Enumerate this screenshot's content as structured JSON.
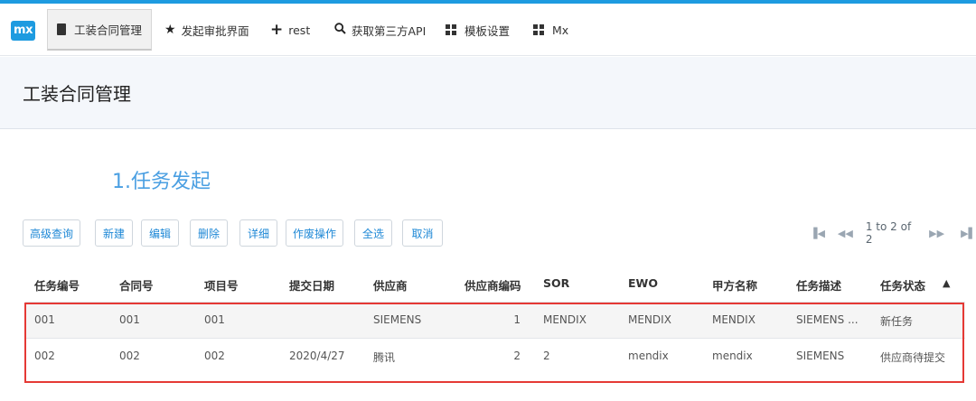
{
  "brand": {
    "logo_text": "mx"
  },
  "nav": [
    {
      "label": "工装合同管理",
      "icon": "book-icon",
      "active": true
    },
    {
      "label": "发起审批界面",
      "icon": "star-icon"
    },
    {
      "label": "rest",
      "icon": "plus-icon"
    },
    {
      "label": "获取第三方API",
      "icon": "search-icon"
    },
    {
      "label": "模板设置",
      "icon": "grid-icon"
    },
    {
      "label": "Mx",
      "icon": "grid-icon"
    }
  ],
  "page": {
    "title": "工装合同管理",
    "section_title": "1.任务发起"
  },
  "toolbar": [
    {
      "label": "高级查询"
    },
    {
      "label": "新建"
    },
    {
      "label": "编辑"
    },
    {
      "label": "删除"
    },
    {
      "label": "详细"
    },
    {
      "label": "作废操作"
    },
    {
      "label": "全选"
    },
    {
      "label": "取消"
    }
  ],
  "pager": {
    "text": "1 to 2 of 2"
  },
  "table": {
    "columns": [
      "任务编号",
      "合同号",
      "项目号",
      "提交日期",
      "供应商",
      "供应商编码",
      "SOR",
      "EWO",
      "甲方名称",
      "任务描述",
      "任务状态"
    ],
    "sort_indicator": "▲",
    "rows": [
      [
        "001",
        "001",
        "001",
        "",
        "SIEMENS",
        "1",
        "MENDIX",
        "MENDIX",
        "MENDIX",
        "SIEMENS ...",
        "新任务"
      ],
      [
        "002",
        "002",
        "002",
        "2020/4/27",
        "腾讯",
        "2",
        "2",
        "mendix",
        "mendix",
        "SIEMENS",
        "供应商待提交"
      ]
    ]
  },
  "colors": {
    "accent": "#1e9be0",
    "title_blue": "#4a9fe2",
    "highlight": "#e53935"
  }
}
